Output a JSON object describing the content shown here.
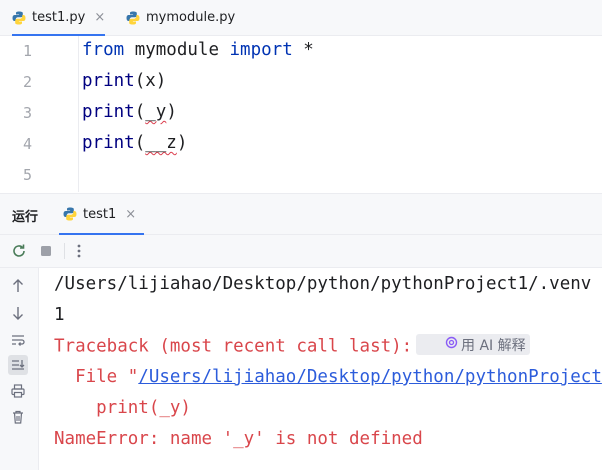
{
  "editor_tabs": [
    {
      "label": "test1.py",
      "close": "×",
      "active": true
    },
    {
      "label": "mymodule.py",
      "active": false
    }
  ],
  "editor": {
    "line_numbers": [
      "1",
      "2",
      "3",
      "4",
      "5"
    ],
    "lines": [
      {
        "kw1": "from",
        "mid": " mymodule ",
        "kw2": "import",
        "tail": " *"
      },
      {
        "fn": "print",
        "open": "(",
        "arg": "x",
        "close": ")"
      },
      {
        "fn": "print",
        "open": "(",
        "arg": "_y",
        "close": ")"
      },
      {
        "fn": "print",
        "open": "(",
        "arg": "__z",
        "close": ")"
      }
    ]
  },
  "run_panel": {
    "title": "运行",
    "tab_label": "test1",
    "tab_close": "×"
  },
  "toolbar_icons": [
    "rerun-icon",
    "stop-icon",
    "more-options-icon"
  ],
  "side_icons": [
    "scroll-up-icon",
    "scroll-down-icon",
    "soft-wrap-icon",
    "scroll-to-end-icon",
    "print-icon",
    "trash-icon"
  ],
  "console": {
    "path_line": "/Users/lijiahao/Desktop/python/pythonProject1/.venv",
    "output": "1",
    "traceback": "Traceback (most recent call last):",
    "ai_button": "用 AI 解释",
    "file_prefix": "  File \"",
    "file_link": "/Users/lijiahao/Desktop/python/pythonProject",
    "code_line": "    print(_y)",
    "error": "NameError: name '_y' is not defined"
  },
  "colors": {
    "accent": "#3574f0",
    "error": "#d9464b",
    "link": "#2c5cdb",
    "keyword": "#0033b3",
    "line_number": "#a3a6ad"
  }
}
